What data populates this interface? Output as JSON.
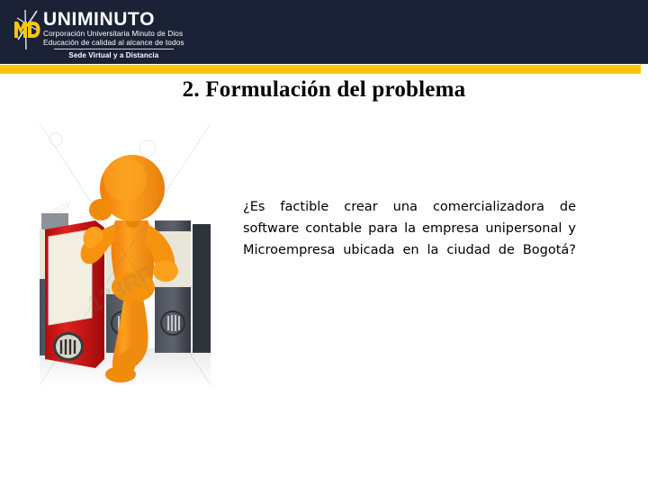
{
  "header": {
    "background_color": "#1b2236",
    "accent_color": "#fbc50d",
    "logo": {
      "monogram": "MD",
      "wordmark": "UNIMINUTO",
      "line1": "Corporación Universitaria Minuto de Dios",
      "line2": "Educación de calidad al alcance de todos",
      "line3": "Sede Virtual y a Distancia"
    }
  },
  "slide": {
    "title": "2. Formulación del problema",
    "body": "¿Es factible crear una comercializadora de software contable para la empresa unipersonal y Microempresa ubicada en la ciudad de Bogotá?",
    "illustration": {
      "name": "thinking-person-with-binders",
      "figure_color": "#f59a16",
      "front_binder_color": "#cc1111",
      "back_binder_color": "#3b4049",
      "watermark": "123RF"
    }
  }
}
